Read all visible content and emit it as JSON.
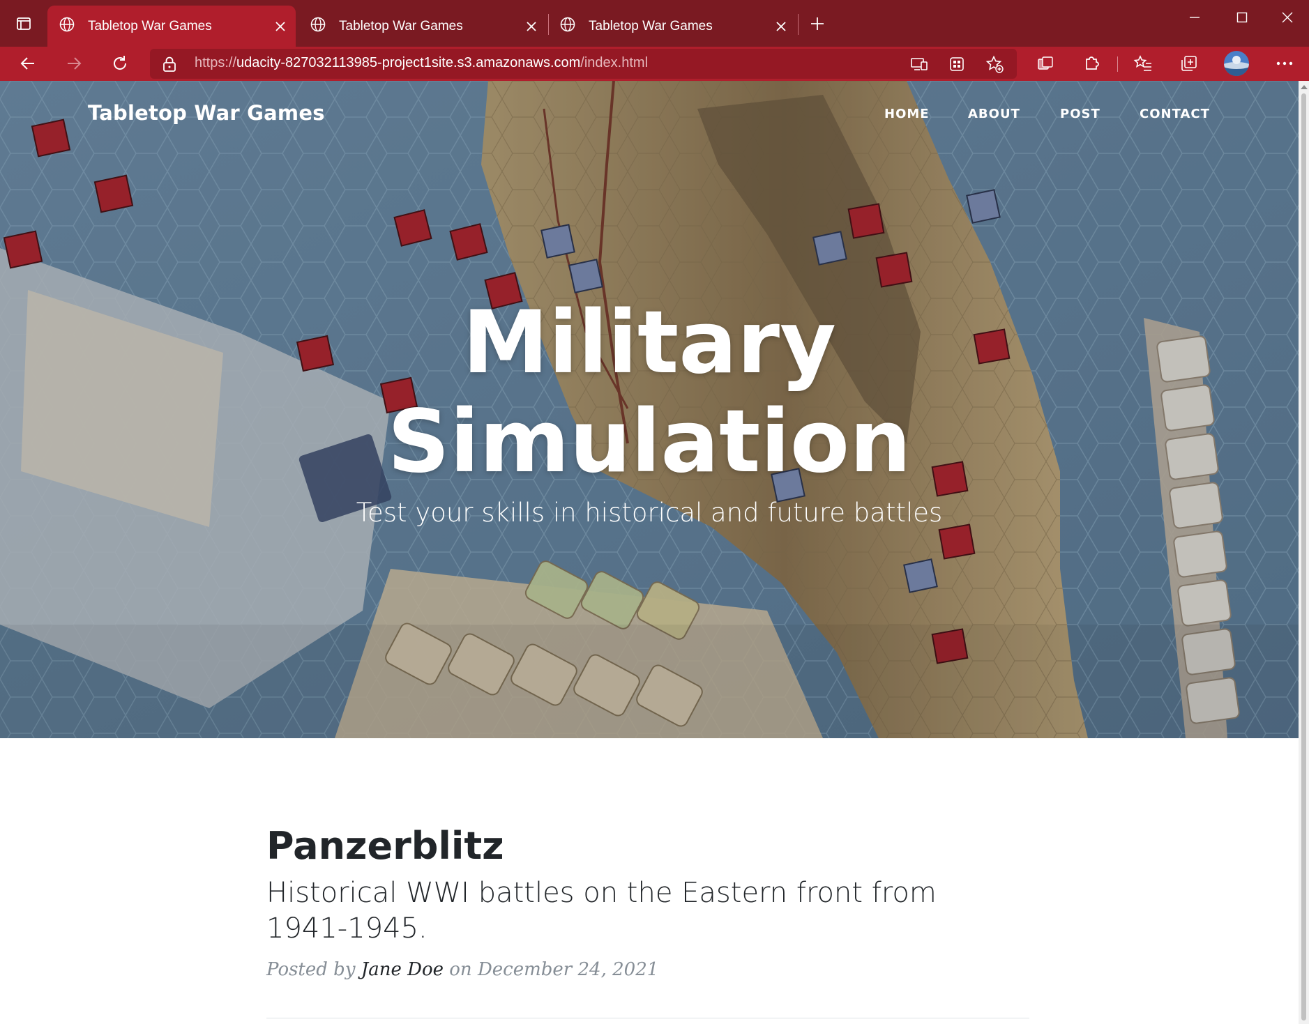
{
  "browser": {
    "tabs": [
      {
        "title": "Tabletop War Games",
        "active": true
      },
      {
        "title": "Tabletop War Games",
        "active": false
      },
      {
        "title": "Tabletop War Games",
        "active": false
      }
    ],
    "address": {
      "url_prefix": "https://",
      "url_domain": "udacity-827032113985-project1site.s3.amazonaws.com",
      "url_path": "/index.html"
    },
    "colors": {
      "tabbar": "#7a1a22",
      "toolbar": "#b01e2c",
      "address_bg": "#951824"
    },
    "icons": [
      "tab-actions-icon",
      "globe-icon",
      "close-icon",
      "plus-icon",
      "minimize-icon",
      "maximize-icon",
      "back-icon",
      "forward-icon",
      "refresh-icon",
      "lock-icon",
      "app-available-icon",
      "immersive-reader-icon",
      "add-favorite-icon",
      "sidebar-icon",
      "extensions-icon",
      "favorites-icon",
      "collections-icon",
      "profile-avatar",
      "more-icon"
    ]
  },
  "site": {
    "brand": "Tabletop War Games",
    "nav": [
      "HOME",
      "ABOUT",
      "POST",
      "CONTACT"
    ],
    "hero": {
      "heading_line1": "Military",
      "heading_line2": "Simulation",
      "subheading": "Test your skills in historical and future battles"
    },
    "post": {
      "title": "Panzerblitz",
      "subtitle": "Historical WWI battles on the Eastern front from 1941-1945.",
      "meta_prefix": "Posted by",
      "author": "Jane Doe",
      "meta_on": "on",
      "date": "December 24, 2021"
    }
  }
}
